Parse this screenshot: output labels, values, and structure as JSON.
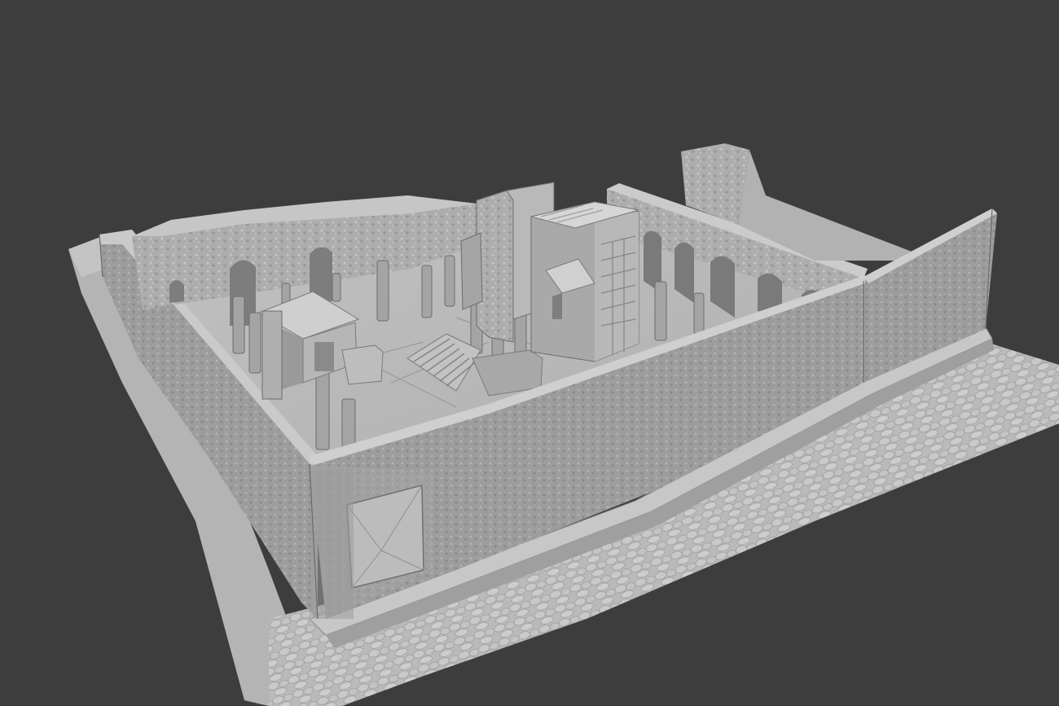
{
  "viewport": {
    "background_color": "#3d3d3d",
    "subject": "3d-scan-mesh",
    "shading": "solid-matcap-grey",
    "colors": {
      "mesh_light": "#c9c9c9",
      "mesh_mid": "#a9a9a9",
      "mesh_dark": "#7a7a7a",
      "mesh_shadow": "#5e5e5e"
    }
  }
}
